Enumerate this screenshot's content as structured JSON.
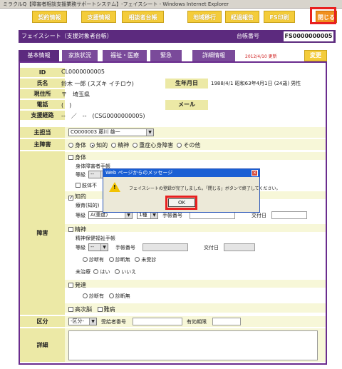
{
  "window": {
    "title": "ミラクルQ【障害者相談支援業務サポートシステム】-フェイスシート - Windows Internet Explorer"
  },
  "nav": {
    "contract": "契約情報",
    "support": "支援情報",
    "consultant": "相談者台帳",
    "regional": "地域移行",
    "progress": "経過報告",
    "fs_print": "FS印刷",
    "close": "閉じる"
  },
  "sheet": {
    "title": "フェイスシート（支援対象者台帳）",
    "ledger_label": "台帳番号",
    "ledger_value": "FS0000000005"
  },
  "tabs": [
    "基本情報",
    "家族状況",
    "福祉・医療",
    "緊急",
    "詳細情報"
  ],
  "updated": "2012/4/10 更新",
  "change_label": "変更",
  "basic": {
    "id_label": "ID",
    "id_value": "CL0000000005",
    "name_label": "氏名",
    "name_value": "鈴木 一郎 (スズキ イチロウ)",
    "birth_label": "生年月日",
    "birth_value": "1988/4/1 昭和63年4月1日 (24歳) 男性",
    "address_label": "現住所",
    "address_value": "〒　埼玉県",
    "phone_label": "電話",
    "phone_value": "(　)",
    "mail_label": "メール",
    "route_label": "支援経路",
    "route_value": "--　／　--　(CSG0000000005)"
  },
  "manager": {
    "label": "主担当",
    "selected": "CO000003 藤川 雄一"
  },
  "disability_main": {
    "label": "主障害",
    "options": [
      "身体",
      "知的",
      "精神",
      "重症心身障害",
      "その他"
    ]
  },
  "disability": {
    "label": "障害",
    "physical": {
      "check": "身体",
      "notebook": "身体障害者手帳",
      "grade_label": "等級",
      "select": "--",
      "body_label": "肢体不"
    },
    "intellectual": {
      "check": "知的",
      "notebook": "療育(知的)",
      "grade_label": "等級",
      "grade_select": "A(重度)",
      "type_select": "1種",
      "number_label": "手帳番号",
      "issue_label": "交付日"
    },
    "mental": {
      "check": "精神",
      "notebook": "精神保健福祉手帳",
      "grade_label": "等級",
      "grade_select": "--",
      "number_label": "手帳番号",
      "issue_label": "交付日",
      "diag_options": [
        "診断有",
        "診断無",
        "未受診"
      ],
      "untreated_label": "未治療",
      "yesno": [
        "はい",
        "いいえ"
      ]
    },
    "developmental": {
      "check": "発達",
      "diag_options": [
        "診断有",
        "診断無"
      ]
    },
    "higher": "高次脳",
    "intractable": "難病"
  },
  "category": {
    "label": "区分",
    "select": "-区分-",
    "number_label": "受給者番号",
    "period_label": "有効期限"
  },
  "detail": {
    "label": "詳細"
  },
  "dialog": {
    "title": "Web ページからのメッセージ",
    "message": "フェイスシートの登録が完了しました。「閉じる」ボタンで終了してください。",
    "ok": "OK"
  },
  "colors": {
    "accent": "#5c2a7e",
    "button": "#f4cc3a",
    "close": "#f09020",
    "highlight": "#e82020",
    "label_bg": "#ece9a6"
  }
}
